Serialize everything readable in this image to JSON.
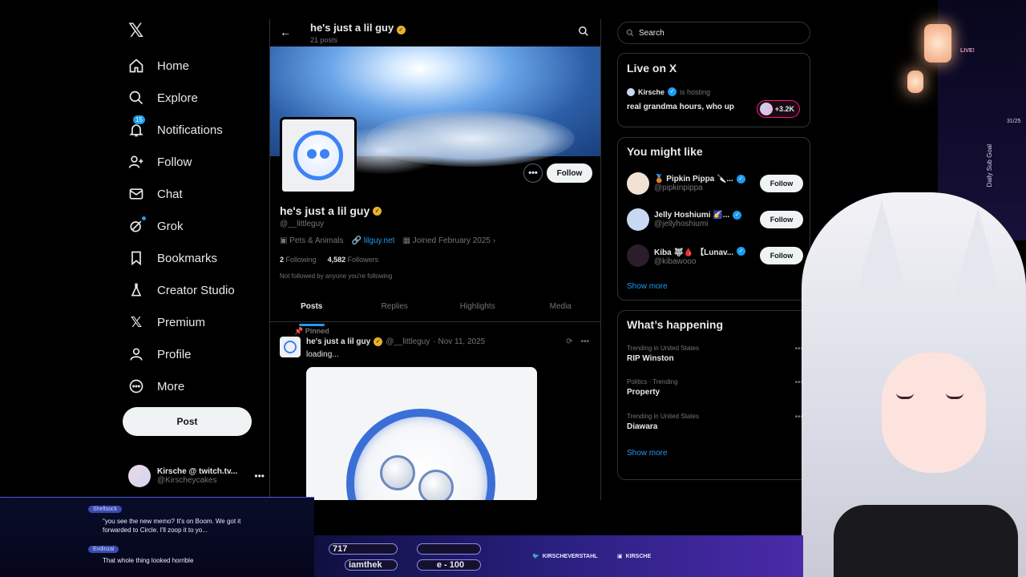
{
  "nav": {
    "items": [
      {
        "label": "Home",
        "icon": "home-icon"
      },
      {
        "label": "Explore",
        "icon": "search-icon"
      },
      {
        "label": "Notifications",
        "icon": "bell-icon",
        "badge": "15"
      },
      {
        "label": "Follow",
        "icon": "person-plus-icon"
      },
      {
        "label": "Chat",
        "icon": "mail-icon"
      },
      {
        "label": "Grok",
        "icon": "grok-icon"
      },
      {
        "label": "Bookmarks",
        "icon": "bookmark-icon"
      },
      {
        "label": "Creator Studio",
        "icon": "flask-icon"
      },
      {
        "label": "Premium",
        "icon": "x-logo-icon"
      },
      {
        "label": "Profile",
        "icon": "person-icon"
      },
      {
        "label": "More",
        "icon": "more-circle-icon"
      }
    ],
    "post_label": "Post",
    "account": {
      "name": "Kirsche @ twitch.tv...",
      "handle": "@Kirscheycakes"
    }
  },
  "profile": {
    "top_name": "he's just a lil guy",
    "top_posts": "21 posts",
    "name": "he's just a lil guy",
    "handle": "@__littleguy",
    "category": "Pets & Animals",
    "website": "lilguy.net",
    "joined": "Joined February 2025",
    "following_count": "2",
    "following_label": "Following",
    "followers_count": "4,582",
    "followers_label": "Followers",
    "not_followed": "Not followed by anyone you're following",
    "follow_label": "Follow",
    "more_label": "•••"
  },
  "tabs": [
    "Posts",
    "Replies",
    "Highlights",
    "Media"
  ],
  "tweet": {
    "pinned": "Pinned",
    "name": "he's just a lil guy",
    "handle": "@__littleguy",
    "date": "· Nov 11, 2025",
    "text": "loading..."
  },
  "right": {
    "search_placeholder": "Search",
    "live": {
      "title": "Live on X",
      "host": "Kirsche",
      "hosting": "is hosting",
      "title_text": "real grandma hours, who up",
      "count": "+3.2K"
    },
    "might_like": {
      "title": "You might like",
      "users": [
        {
          "name": "🥉 Pipkin Pippa 🔪...",
          "handle": "@pipkinpippa",
          "color": "#f1e2d4"
        },
        {
          "name": "Jelly Hoshiumi 🌠...",
          "handle": "@jellyhoshiumi",
          "color": "#c9d8f2"
        },
        {
          "name": "Kiba 🐺🩸 【Lunav...",
          "handle": "@kibawooo",
          "color": "#2a1e2a"
        }
      ],
      "follow_label": "Follow",
      "show_more": "Show more"
    },
    "happening": {
      "title": "What’s happening",
      "trends": [
        {
          "context": "Trending in United States",
          "topic": "RIP Winston"
        },
        {
          "context": "Politics · Trending",
          "topic": "Property"
        },
        {
          "context": "Trending in United States",
          "topic": "Diawara"
        }
      ],
      "show_more": "Show more"
    }
  },
  "stream": {
    "chat": [
      {
        "user": "Shellsock",
        "msg": "\"you see the new memo? It's on Boom. We got it forwarded to Circle. I'll zoop it to yo..."
      },
      {
        "user": "Evdinzai",
        "msg": "That whole thing looked horrible"
      }
    ],
    "counter_value": "717",
    "user_label": "iamthek",
    "score_label": "e - 100",
    "twitter_tag": "KIRSCHEVERSTAHL",
    "twitch_tag": "KIRSCHE",
    "live_badge": "LIVE!",
    "sub_goal": "Daily Sub Goal",
    "sub_count": "31/25"
  }
}
